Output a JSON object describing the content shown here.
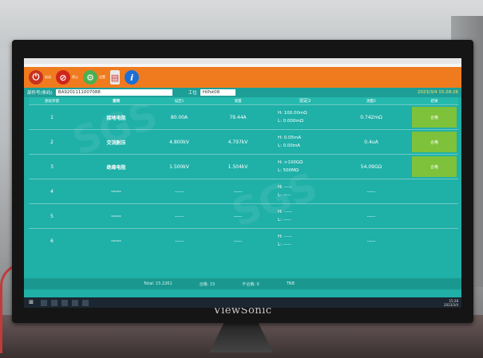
{
  "toolbar": {
    "buttons": [
      {
        "icon": "power-icon",
        "label": "启动"
      },
      {
        "icon": "stop-icon",
        "label": "停止"
      },
      {
        "icon": "settings-icon",
        "label": "设置"
      },
      {
        "icon": "report-icon",
        "label": ""
      },
      {
        "icon": "info-icon",
        "label": "i"
      }
    ]
  },
  "info": {
    "part_label": "部件号(条码)",
    "part_value": "BA9201111007088",
    "station_label": "工位",
    "station_value": "HiPot08",
    "datetime": "2023/3/4 15:28:26"
  },
  "table": {
    "headers": [
      "测试步骤",
      "测项",
      "设定1",
      "测量",
      "设定2",
      "测量2",
      "结果"
    ],
    "rows": [
      {
        "num": "1",
        "name": "接地电阻",
        "set": "80.00A",
        "meas": "79.44A",
        "limit_h": "H: 100.00mΩ",
        "limit_l": "L: 0.000mΩ",
        "meas2": "0.742mΩ",
        "result": "合格"
      },
      {
        "num": "2",
        "name": "交流耐压",
        "set": "4.800kV",
        "meas": "4.797kV",
        "limit_h": "H: 0.05mA",
        "limit_l": "L: 0.00mA",
        "meas2": "0.4uA",
        "result": "合格"
      },
      {
        "num": "3",
        "name": "绝缘电阻",
        "set": "1.500kV",
        "meas": "1.504kV",
        "limit_h": "H: >100GΩ",
        "limit_l": "L: 500MΩ",
        "meas2": "54.09GΩ",
        "result": "合格"
      },
      {
        "num": "4",
        "name": "-----",
        "set": "-----",
        "meas": "-----",
        "limit_h": "H: -----",
        "limit_l": "L: -----",
        "meas2": "-----",
        "result": ""
      },
      {
        "num": "5",
        "name": "-----",
        "set": "-----",
        "meas": "-----",
        "limit_h": "H: -----",
        "limit_l": "L: -----",
        "meas2": "-----",
        "result": ""
      },
      {
        "num": "6",
        "name": "-----",
        "set": "-----",
        "meas": "-----",
        "limit_h": "H: -----",
        "limit_l": "L: -----",
        "meas2": "-----",
        "result": ""
      }
    ]
  },
  "footer": {
    "total": "Total: 15.2261",
    "pass": "合格: 15",
    "fail": "不合格: 0",
    "yield": "TNB"
  },
  "taskbar": {
    "time": "15:28",
    "date": "2023/3/4"
  },
  "monitor": {
    "brand": "ViewSonic"
  },
  "colors": {
    "toolbar": "#f07b1e",
    "screen": "#1fb0a8",
    "pass": "#7ec13a"
  }
}
